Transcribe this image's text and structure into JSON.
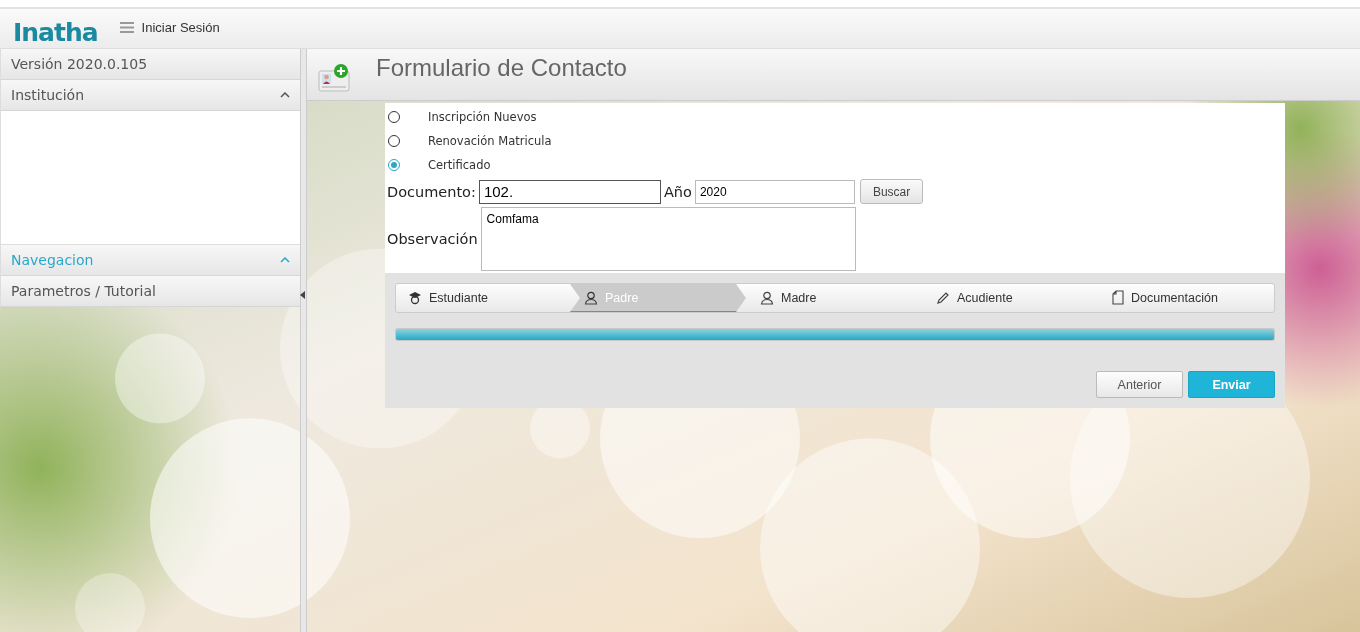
{
  "header": {
    "logo": "Inatha",
    "login_link": "Iniciar Sesión"
  },
  "sidebar": {
    "version": "Versión 2020.0.105",
    "sections": [
      {
        "title": "Institución",
        "expanded": true,
        "active": false
      },
      {
        "title": "Navegacion",
        "expanded": true,
        "active": true,
        "items": [
          "Parametros / Tutorial"
        ]
      }
    ]
  },
  "page": {
    "title": "Formulario de Contacto"
  },
  "form": {
    "options": [
      {
        "label": "Inscripción Nuevos",
        "selected": false
      },
      {
        "label": "Renovación Matricula",
        "selected": false
      },
      {
        "label": "Certificado",
        "selected": true
      }
    ],
    "document_label": "Documento:",
    "document_value": "102.",
    "year_label": "Año",
    "year_value": "2020",
    "search_button": "Buscar",
    "observation_label": "Observación",
    "observation_value": "Comfama"
  },
  "wizard": {
    "steps": [
      {
        "label": "Estudiante",
        "kind": "student",
        "selected": false
      },
      {
        "label": "Padre",
        "kind": "person",
        "selected": true
      },
      {
        "label": "Madre",
        "kind": "person",
        "selected": false
      },
      {
        "label": "Acudiente",
        "kind": "pencil",
        "selected": false
      },
      {
        "label": "Documentación",
        "kind": "document",
        "selected": false
      }
    ],
    "progress": {
      "level": 1
    },
    "buttons": [
      {
        "label": "Anterior",
        "kind": "secondary"
      },
      {
        "label": "Enviar",
        "kind": "primary"
      }
    ]
  }
}
